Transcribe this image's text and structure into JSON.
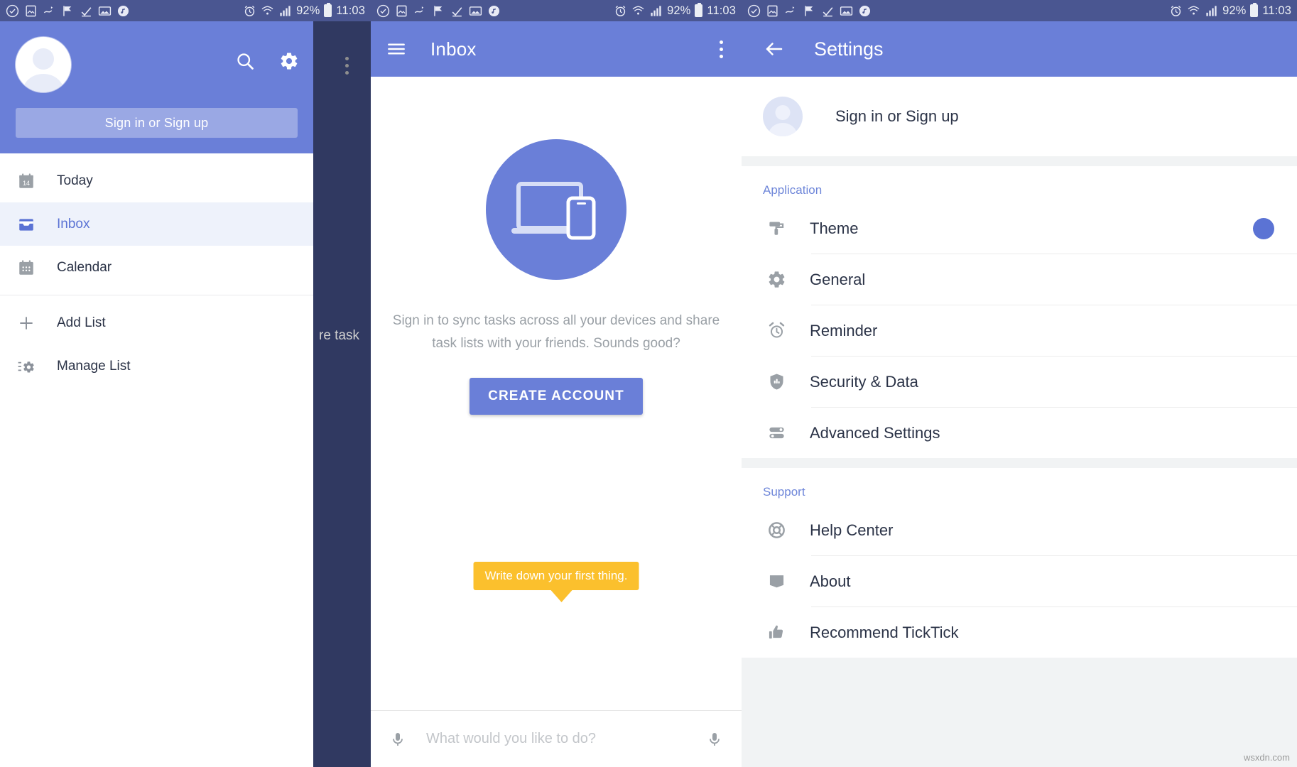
{
  "status_bar": {
    "notification_icons": [
      "check-circle-icon",
      "image-icon",
      "sync-icon",
      "flag-icon",
      "task-check-icon",
      "photo-icon",
      "music-note-icon"
    ],
    "alarm_icon": "alarm-icon",
    "wifi_icon": "wifi-icon",
    "signal_icon": "signal-bars-icon",
    "battery_percent": "92%",
    "battery_icon": "battery-icon",
    "time": "11:03"
  },
  "drawer_panel": {
    "avatar": "user-avatar-placeholder",
    "search_icon": "search-icon",
    "settings_icon": "gear-icon",
    "sign_in_button": "Sign in or Sign up",
    "items": [
      {
        "label": "Today",
        "icon": "calendar-today-icon",
        "badge": "14",
        "active": false
      },
      {
        "label": "Inbox",
        "icon": "inbox-icon",
        "active": true
      },
      {
        "label": "Calendar",
        "icon": "calendar-icon",
        "active": false
      },
      {
        "label": "Add List",
        "icon": "plus-icon",
        "active": false
      },
      {
        "label": "Manage List",
        "icon": "manage-list-icon",
        "active": false
      }
    ],
    "background_text": "re task"
  },
  "inbox_panel": {
    "menu_icon": "hamburger-menu-icon",
    "title": "Inbox",
    "overflow_icon": "overflow-menu-icon",
    "hero_icon": "devices-sync-icon",
    "description": "Sign in to sync tasks across all your devices and share task lists with your friends. Sounds good?",
    "cta_label": "CREATE ACCOUNT",
    "tooltip": "Write down your first thing.",
    "input_placeholder": "What would you like to do?",
    "mic_icon_left": "microphone-icon",
    "mic_icon_right": "microphone-icon"
  },
  "settings_panel": {
    "back_icon": "back-arrow-icon",
    "title": "Settings",
    "account_label": "Sign in or Sign up",
    "account_avatar": "user-avatar-placeholder",
    "sections": [
      {
        "title": "Application",
        "items": [
          {
            "label": "Theme",
            "icon": "paint-roller-icon",
            "swatch": "#5b73d4"
          },
          {
            "label": "General",
            "icon": "gear-icon"
          },
          {
            "label": "Reminder",
            "icon": "alarm-clock-icon"
          },
          {
            "label": "Security & Data",
            "icon": "shield-icon"
          },
          {
            "label": "Advanced Settings",
            "icon": "sliders-icon"
          }
        ]
      },
      {
        "title": "Support",
        "items": [
          {
            "label": "Help Center",
            "icon": "lifebuoy-icon"
          },
          {
            "label": "About",
            "icon": "book-icon"
          },
          {
            "label": "Recommend TickTick",
            "icon": "thumbs-up-icon"
          }
        ]
      }
    ]
  },
  "watermark": "wsxdn.com",
  "colors": {
    "primary": "#6a7fd8",
    "accent": "#5b73d4",
    "status_bar": "#4a5691",
    "tooltip": "#fbc02d",
    "active_item_bg": "#eef2fb"
  }
}
